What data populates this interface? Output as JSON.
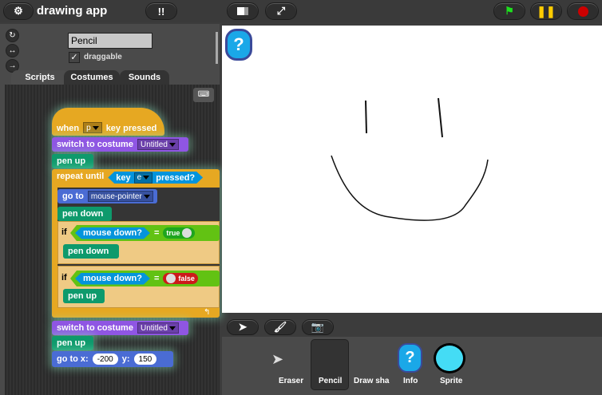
{
  "header": {
    "title": "drawing app"
  },
  "sprite": {
    "name": "Pencil",
    "draggable_label": "draggable",
    "draggable": true
  },
  "tabs": [
    "Scripts",
    "Costumes",
    "Sounds"
  ],
  "blocks": {
    "hat": {
      "when": "when",
      "key": "p",
      "pressed": "key pressed"
    },
    "switch1": {
      "label": "switch to costume",
      "costume": "Untitled"
    },
    "penup1": "pen up",
    "repeat": {
      "label": "repeat until",
      "key": "key",
      "keyval": "e",
      "pressed": "pressed?"
    },
    "goto1": {
      "label": "go to",
      "target": "mouse-pointer"
    },
    "pendown1": "pen down",
    "if1": {
      "if": "if",
      "cond": "mouse down?",
      "eq": "=",
      "val": "true",
      "body": "pen down"
    },
    "if2": {
      "if": "if",
      "cond": "mouse down?",
      "eq": "=",
      "val": "false",
      "body": "pen up"
    },
    "switch2": {
      "label": "switch to costume",
      "costume": "Untitled"
    },
    "penup2": "pen up",
    "goto2": {
      "label": "go to x:",
      "x": "-200",
      "ylabel": "y:",
      "y": "150"
    }
  },
  "corral": {
    "items": [
      "Eraser",
      "Pencil",
      "Draw sha",
      "Info",
      "Sprite"
    ]
  },
  "colors": {
    "stage": "#ffffff",
    "green_flag": "#1ee01e",
    "pause": "#ffcc00",
    "stop": "#cc0000"
  }
}
